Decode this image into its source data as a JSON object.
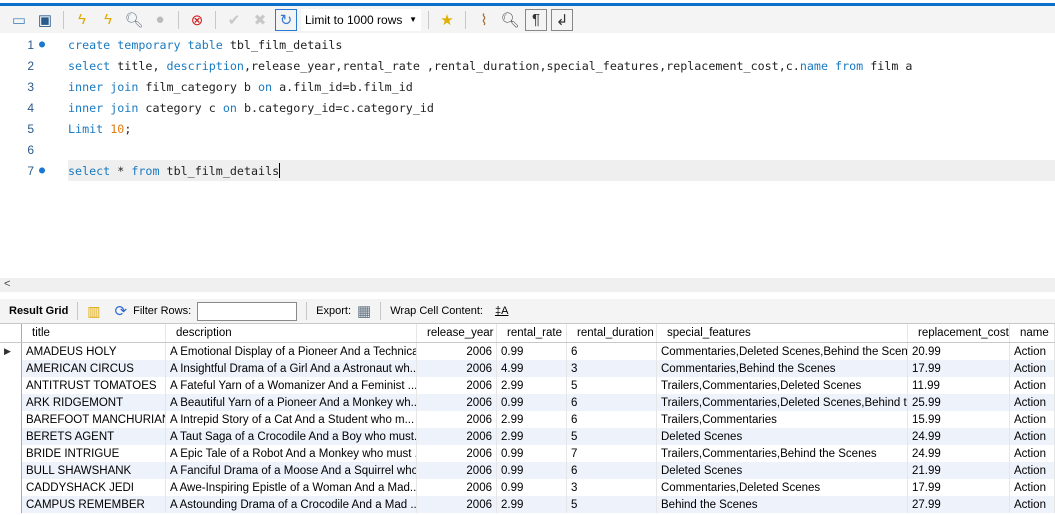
{
  "toolbar": {
    "icons": [
      "open-folder-icon",
      "save-icon",
      "execute-icon",
      "execute-current-icon",
      "explain-icon",
      "stop-icon",
      "toggle-error-icon",
      "commit-icon",
      "rollback-icon",
      "autocommit-icon",
      "add-snippet-icon",
      "beautify-icon",
      "find-icon",
      "invisible-chars-icon",
      "wrap-icon"
    ],
    "limit_label": "Limit to 1000 rows"
  },
  "editor": {
    "lines": [
      {
        "n": "1",
        "dot": true,
        "tokens": [
          [
            "kw",
            "create temporary table"
          ],
          [
            "pl",
            " tbl_film_details"
          ]
        ]
      },
      {
        "n": "2",
        "dot": false,
        "tokens": [
          [
            "kw",
            "select"
          ],
          [
            "pl",
            " title, "
          ],
          [
            "kw",
            "description"
          ],
          [
            "pl",
            ",release_year,rental_rate ,rental_duration,special_features,replacement_cost,c."
          ],
          [
            "kw",
            "name"
          ],
          [
            "pl",
            " "
          ],
          [
            "kw",
            "from"
          ],
          [
            "pl",
            " film a"
          ]
        ]
      },
      {
        "n": "3",
        "dot": false,
        "tokens": [
          [
            "kw",
            "inner join"
          ],
          [
            "pl",
            " film_category b "
          ],
          [
            "kw",
            "on"
          ],
          [
            "pl",
            " a.film_id=b.film_id"
          ]
        ]
      },
      {
        "n": "4",
        "dot": false,
        "tokens": [
          [
            "kw",
            "inner join"
          ],
          [
            "pl",
            " category c "
          ],
          [
            "kw",
            "on"
          ],
          [
            "pl",
            " b.category_id=c.category_id"
          ]
        ]
      },
      {
        "n": "5",
        "dot": false,
        "tokens": [
          [
            "kw",
            "Limit"
          ],
          [
            "pl",
            " "
          ],
          [
            "num",
            "10"
          ],
          [
            "pl",
            ";"
          ]
        ]
      },
      {
        "n": "6",
        "dot": false,
        "tokens": []
      },
      {
        "n": "7",
        "dot": true,
        "tokens": [
          [
            "kw",
            "select"
          ],
          [
            "pl",
            " * "
          ],
          [
            "kw",
            "from"
          ],
          [
            "pl",
            " tbl_film_details"
          ]
        ]
      }
    ]
  },
  "scroll": {
    "left_arrow": "<"
  },
  "result_toolbar": {
    "result_grid": "Result Grid",
    "filter_rows": "Filter Rows:",
    "filter_value": "",
    "export": "Export:",
    "wrap": "Wrap Cell Content:"
  },
  "grid": {
    "columns": [
      "title",
      "description",
      "release_year",
      "rental_rate",
      "rental_duration",
      "special_features",
      "replacement_cost",
      "name"
    ],
    "rows": [
      [
        "AMADEUS HOLY",
        "A Emotional Display of a Pioneer And a Technica...",
        "2006",
        "0.99",
        "6",
        "Commentaries,Deleted Scenes,Behind the Scenes",
        "20.99",
        "Action"
      ],
      [
        "AMERICAN CIRCUS",
        "A Insightful Drama of a Girl And a Astronaut wh...",
        "2006",
        "4.99",
        "3",
        "Commentaries,Behind the Scenes",
        "17.99",
        "Action"
      ],
      [
        "ANTITRUST TOMATOES",
        "A Fateful Yarn of a Womanizer And a Feminist ...",
        "2006",
        "2.99",
        "5",
        "Trailers,Commentaries,Deleted Scenes",
        "11.99",
        "Action"
      ],
      [
        "ARK RIDGEMONT",
        "A Beautiful Yarn of a Pioneer And a Monkey wh...",
        "2006",
        "0.99",
        "6",
        "Trailers,Commentaries,Deleted Scenes,Behind t...",
        "25.99",
        "Action"
      ],
      [
        "BAREFOOT MANCHURIAN",
        "A Intrepid Story of a Cat And a Student who m...",
        "2006",
        "2.99",
        "6",
        "Trailers,Commentaries",
        "15.99",
        "Action"
      ],
      [
        "BERETS AGENT",
        "A Taut Saga of a Crocodile And a Boy who must...",
        "2006",
        "2.99",
        "5",
        "Deleted Scenes",
        "24.99",
        "Action"
      ],
      [
        "BRIDE INTRIGUE",
        "A Epic Tale of a Robot And a Monkey who must ...",
        "2006",
        "0.99",
        "7",
        "Trailers,Commentaries,Behind the Scenes",
        "24.99",
        "Action"
      ],
      [
        "BULL SHAWSHANK",
        "A Fanciful Drama of a Moose And a Squirrel who...",
        "2006",
        "0.99",
        "6",
        "Deleted Scenes",
        "21.99",
        "Action"
      ],
      [
        "CADDYSHACK JEDI",
        "A Awe-Inspiring Epistle of a Woman And a Mad...",
        "2006",
        "0.99",
        "3",
        "Commentaries,Deleted Scenes",
        "17.99",
        "Action"
      ],
      [
        "CAMPUS REMEMBER",
        "A Astounding Drama of a Crocodile And a Mad ...",
        "2006",
        "2.99",
        "5",
        "Behind the Scenes",
        "27.99",
        "Action"
      ]
    ]
  }
}
